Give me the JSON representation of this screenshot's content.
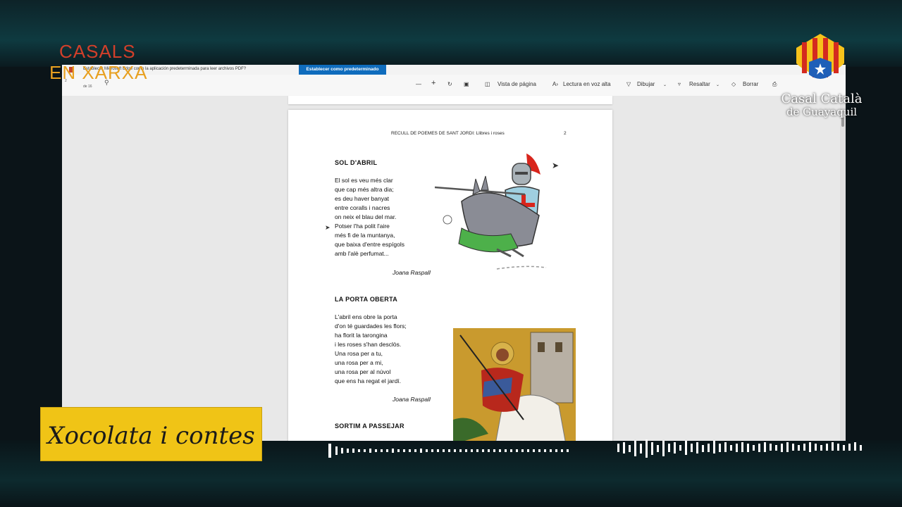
{
  "overlay": {
    "logo_line1": "CASALS",
    "logo_line2": "EN XARXA",
    "casal_name": "Casal Català",
    "casal_city": "de Guayaquil",
    "show_title": "Xocolata i contes"
  },
  "browser": {
    "infobar_message": "Establecer Microsoft Edge como la aplicación predeterminada para leer archivos PDF?",
    "set_default_label": "Establecer como predeterminado",
    "page_current": "2",
    "page_total": "de 16",
    "toolbar": {
      "zoom_out": "—",
      "zoom_in": "+",
      "page_view": "Vista de página",
      "read_aloud": "Lectura en voz alta",
      "draw": "Dibujar",
      "highlight": "Resaltar",
      "erase": "Borrar"
    }
  },
  "document": {
    "header": "RECULL DE POEMES DE SANT JORDI: Llibres i roses",
    "page_number": "2",
    "poems": [
      {
        "title": "SOL D'ABRIL",
        "lines": [
          "El sol es veu més clar",
          "que cap més altra dia;",
          "es deu haver banyat",
          "entre coralls i nacres",
          "on neix el blau del mar.",
          "Potser l'ha polit l'aire",
          "més fi de la muntanya,",
          "que baixa d'entre espígols",
          "amb l'alè perfumat..."
        ],
        "author": "Joana Raspall"
      },
      {
        "title": "LA PORTA OBERTA",
        "lines": [
          "L'abril ens obre la porta",
          "d'on té guardades les flors;",
          "ha florit la tarongina",
          "i les roses s'han desclòs.",
          "Una rosa per a tu,",
          "una rosa per a mi,",
          "una rosa per al núvol",
          "que ens ha regat el jardí."
        ],
        "author": "Joana Raspall"
      },
      {
        "title": "SORTIM A PASSEJAR"
      }
    ]
  },
  "colors": {
    "banner": "#f0c416",
    "logo_red": "#d23f2a",
    "logo_orange": "#e8a020",
    "edge_blue": "#0f6cbd"
  }
}
